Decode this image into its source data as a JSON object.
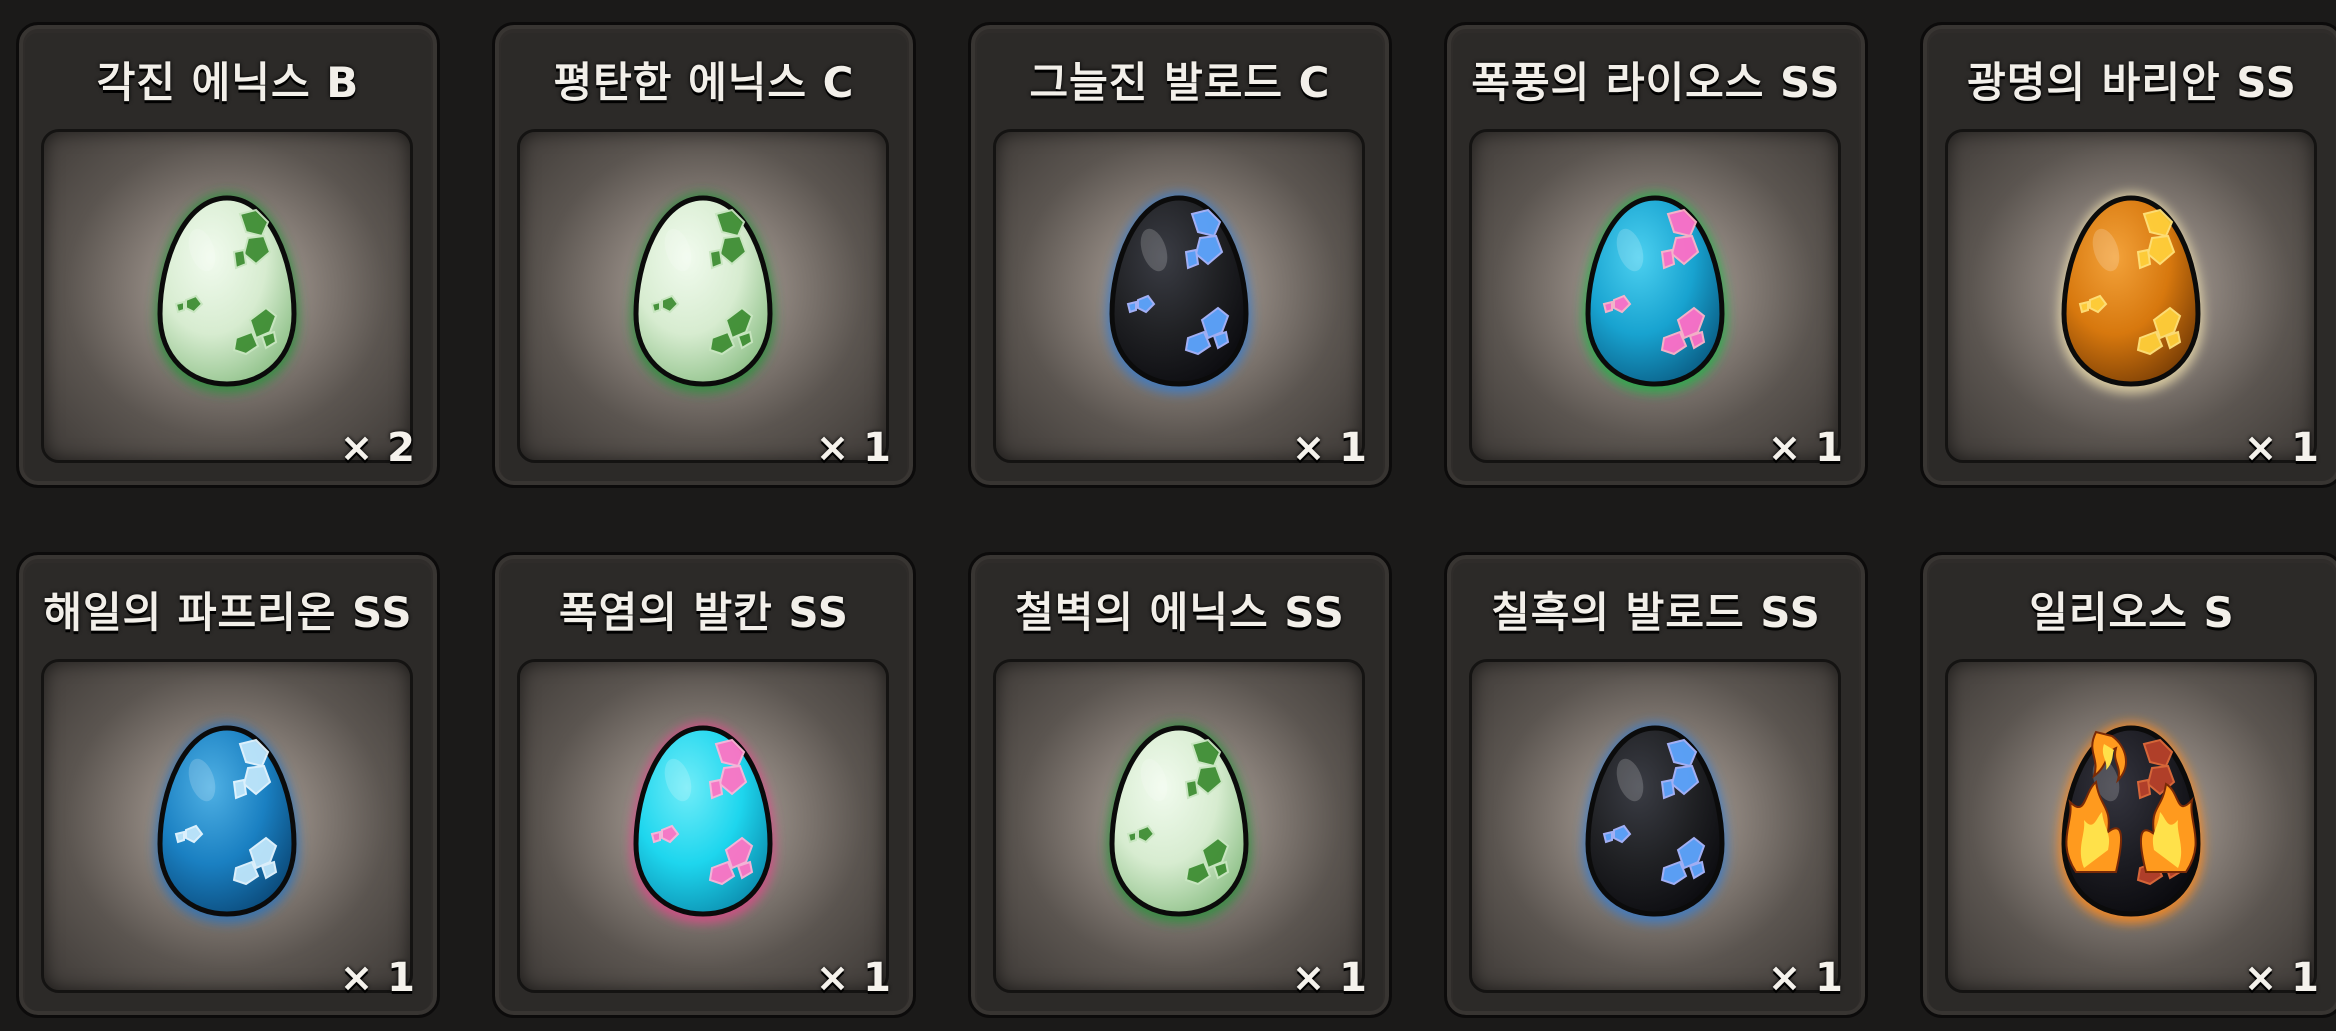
{
  "inventory": {
    "items": [
      {
        "name": "각진 에닉스 B",
        "qty": "× 2",
        "egg": "green-egg-icon",
        "colors": {
          "base": "#d7ecd0",
          "light": "#f1fbee",
          "dark": "#8fc189",
          "spot": "#3f8e34",
          "spotLight": "#c8e6c0",
          "glow": "#2e8f3c"
        }
      },
      {
        "name": "평탄한 에닉스 C",
        "qty": "× 1",
        "egg": "green-egg-icon",
        "colors": {
          "base": "#d7ecd0",
          "light": "#f1fbee",
          "dark": "#8fc189",
          "spot": "#3f8e34",
          "spotLight": "#c8e6c0",
          "glow": "#2e8f3c"
        }
      },
      {
        "name": "그늘진 발로드 C",
        "qty": "× 1",
        "egg": "dark-blue-egg-icon",
        "colors": {
          "base": "#202124",
          "light": "#3a3c44",
          "dark": "#0c0c10",
          "spot": "#5ea6ff",
          "spotLight": "#a9b7ff",
          "glow": "#3b7cc8"
        }
      },
      {
        "name": "폭풍의 라이오스 SS",
        "qty": "× 1",
        "egg": "cyan-pink-egg-icon",
        "colors": {
          "base": "#18a3d0",
          "light": "#4cd0f0",
          "dark": "#0a5e86",
          "spot": "#ff6fc7",
          "spotLight": "#ffb3c9",
          "glow": "#28b04a"
        }
      },
      {
        "name": "광명의 바리안 SS",
        "qty": "× 1",
        "egg": "orange-egg-icon",
        "colors": {
          "base": "#d7780e",
          "light": "#f3a23a",
          "dark": "#7a3e05",
          "spot": "#ffcf3a",
          "spotLight": "#ffe27a",
          "glow": "#e6d7a8"
        }
      },
      {
        "name": "해일의 파프리온 SS",
        "qty": "× 1",
        "egg": "blue-egg-icon",
        "colors": {
          "base": "#1a80c2",
          "light": "#4fb0e4",
          "dark": "#0b4a7a",
          "spot": "#bfe6fb",
          "spotLight": "#e6f6ff",
          "glow": "#2e73b8"
        }
      },
      {
        "name": "폭염의 발칸 SS",
        "qty": "× 1",
        "egg": "cyan-pink-egg-icon",
        "colors": {
          "base": "#1ed6ee",
          "light": "#70ecf8",
          "dark": "#0c8fb0",
          "spot": "#ff74c4",
          "spotLight": "#ffb4d8",
          "glow": "#d84c86"
        }
      },
      {
        "name": "철벽의 에닉스 SS",
        "qty": "× 1",
        "egg": "green-egg-icon",
        "colors": {
          "base": "#d7ecd0",
          "light": "#f1fbee",
          "dark": "#8fc189",
          "spot": "#3f8e34",
          "spotLight": "#c8e6c0",
          "glow": "#2e8f3c"
        }
      },
      {
        "name": "칠흑의 발로드 SS",
        "qty": "× 1",
        "egg": "dark-blue-egg-icon",
        "colors": {
          "base": "#202124",
          "light": "#3a3c44",
          "dark": "#0c0c10",
          "spot": "#5ea6ff",
          "spotLight": "#a9b7ff",
          "glow": "#3b7cc8"
        }
      },
      {
        "name": "일리오스 S",
        "qty": "× 1",
        "egg": "fire-egg-icon",
        "colors": {
          "base": "#1c1c22",
          "light": "#34343e",
          "dark": "#0a0a0e",
          "spot": "#b8412a",
          "spotLight": "#e06a3a",
          "glow": "#ff8a1c"
        }
      }
    ]
  }
}
